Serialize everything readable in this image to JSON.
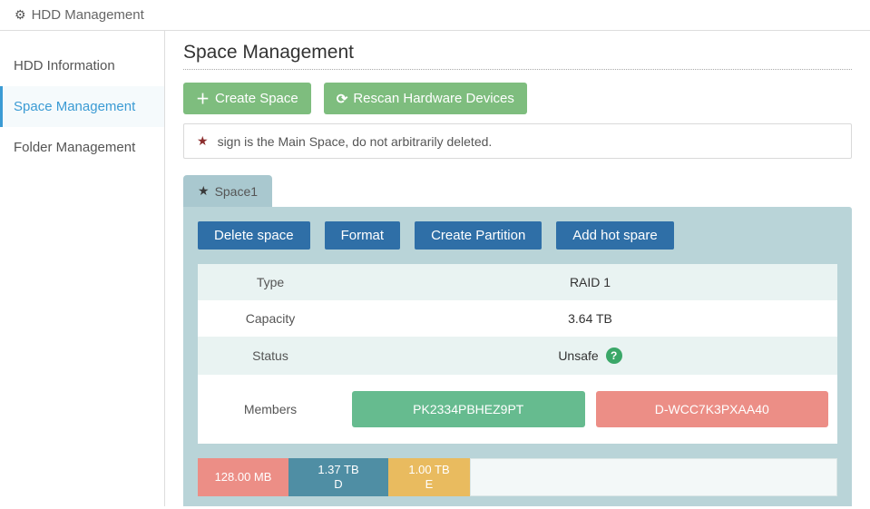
{
  "header": {
    "title": "HDD Management"
  },
  "sidebar": {
    "items": [
      {
        "label": "HDD Information",
        "active": false
      },
      {
        "label": "Space Management",
        "active": true
      },
      {
        "label": "Folder Management",
        "active": false
      }
    ]
  },
  "main": {
    "title": "Space Management",
    "toolbar": {
      "create": "Create Space",
      "rescan": "Rescan Hardware Devices"
    },
    "notice": "sign is the Main Space, do not arbitrarily deleted.",
    "tabs": [
      {
        "label": "Space1",
        "starred": true
      }
    ],
    "spaceActions": {
      "delete": "Delete space",
      "format": "Format",
      "createPartition": "Create Partition",
      "addHotSpare": "Add hot spare"
    },
    "info": {
      "typeLabel": "Type",
      "typeValue": "RAID 1",
      "capacityLabel": "Capacity",
      "capacityValue": "3.64 TB",
      "statusLabel": "Status",
      "statusValue": "Unsafe",
      "membersLabel": "Members",
      "members": [
        {
          "id": "PK2334PBHEZ9PT",
          "state": "ok"
        },
        {
          "id": "D-WCC7K3PXAA40",
          "state": "bad"
        }
      ]
    },
    "partitions": [
      {
        "size": "128.00 MB",
        "letter": "",
        "class": "sys"
      },
      {
        "size": "1.37 TB",
        "letter": "D",
        "class": "d"
      },
      {
        "size": "1.00 TB",
        "letter": "E",
        "class": "e"
      }
    ]
  }
}
